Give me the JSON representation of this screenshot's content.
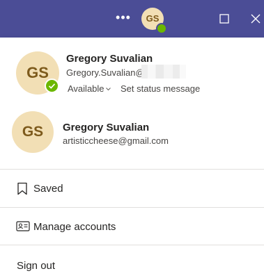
{
  "titlebar": {
    "avatar_initials": "GS",
    "more_icon": "ellipsis-icon",
    "maximize_icon": "maximize-icon",
    "close_icon": "close-icon",
    "status_color": "#6bb700",
    "background_color": "#4b4d96"
  },
  "accounts": [
    {
      "initials": "GS",
      "name": "Gregory Suvalian",
      "email": "Gregory.Suvalian@",
      "status": "Available",
      "status_link": "Set status message",
      "status_color": "#6bb700"
    },
    {
      "initials": "GS",
      "name": "Gregory Suvalian",
      "email": "artisticcheese@gmail.com"
    }
  ],
  "menu": [
    {
      "label": "Saved",
      "icon": "bookmark-icon"
    },
    {
      "label": "Manage accounts",
      "icon": "contact-card-icon"
    },
    {
      "label": "Sign out"
    }
  ],
  "colors": {
    "avatar_bg": "#f2dfb5",
    "avatar_text": "#7d5a1c"
  }
}
